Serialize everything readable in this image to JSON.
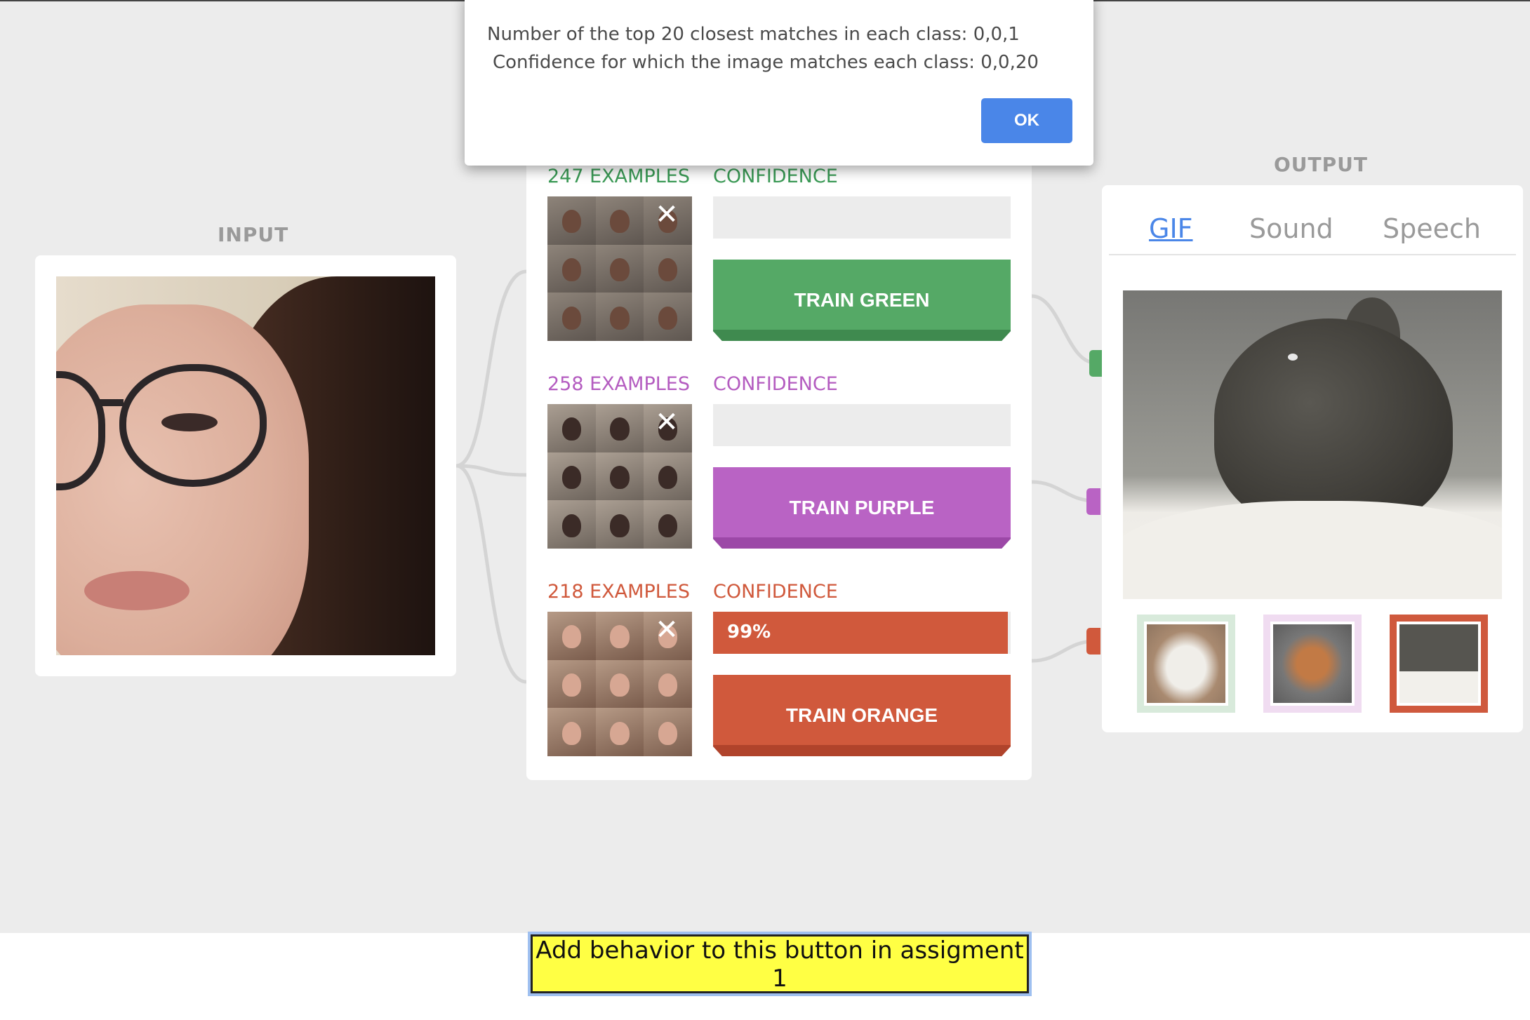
{
  "labels": {
    "input": "INPUT",
    "output": "OUTPUT"
  },
  "dialog": {
    "line1": "Number of the top 20 closest matches in each class: 0,0,1",
    "line2": "Confidence for which the image matches each class: 0,0,20",
    "ok_label": "OK"
  },
  "classes": [
    {
      "examples": "247 EXAMPLES",
      "confidence_label": "CONFIDENCE",
      "confidence": "",
      "confidence_fraction": 0,
      "train_label": "TRAIN GREEN",
      "color": "#55a966"
    },
    {
      "examples": "258 EXAMPLES",
      "confidence_label": "CONFIDENCE",
      "confidence": "",
      "confidence_fraction": 0,
      "train_label": "TRAIN PURPLE",
      "color": "#b963c4"
    },
    {
      "examples": "218 EXAMPLES",
      "confidence_label": "CONFIDENCE",
      "confidence": "99%",
      "confidence_fraction": 0.99,
      "train_label": "TRAIN ORANGE",
      "color": "#d0593c"
    }
  ],
  "output": {
    "tabs": [
      "GIF",
      "Sound",
      "Speech"
    ],
    "active_tab": "GIF"
  },
  "assignment_button": "Add behavior to this button in assigment 1",
  "colors": {
    "accent_blue": "#4a86e8",
    "highlight_yellow": "#ffff44"
  }
}
